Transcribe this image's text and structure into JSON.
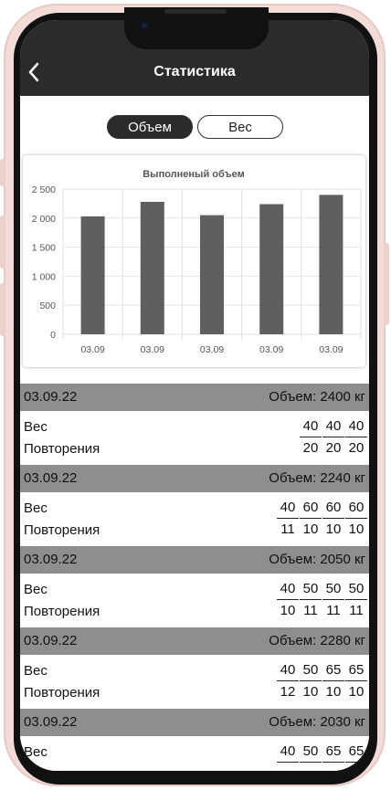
{
  "header": {
    "title": "Статистика"
  },
  "tabs": [
    {
      "label": "Объем",
      "active": true
    },
    {
      "label": "Вес",
      "active": false
    }
  ],
  "chart_data": {
    "type": "bar",
    "title": "Выполненый объем",
    "categories": [
      "03.09",
      "03.09",
      "03.09",
      "03.09",
      "03.09"
    ],
    "values": [
      2030,
      2280,
      2050,
      2240,
      2400
    ],
    "ylim": [
      0,
      2500
    ],
    "yticks": [
      "0",
      "500",
      "1 000",
      "1 500",
      "2 000",
      "2 500"
    ],
    "grid": true,
    "bar_color": "#5f5f5f"
  },
  "labels": {
    "weight": "Вес",
    "reps": "Повторения"
  },
  "sessions": [
    {
      "date": "03.09.22",
      "volume": "Объем: 2400 кг",
      "weights": [
        "40",
        "40",
        "40"
      ],
      "reps": [
        "20",
        "20",
        "20"
      ]
    },
    {
      "date": "03.09.22",
      "volume": "Объем: 2240 кг",
      "weights": [
        "40",
        "60",
        "60",
        "60"
      ],
      "reps": [
        "11",
        "10",
        "10",
        "10"
      ]
    },
    {
      "date": "03.09.22",
      "volume": "Объем: 2050 кг",
      "weights": [
        "40",
        "50",
        "50",
        "50"
      ],
      "reps": [
        "10",
        "11",
        "11",
        "11"
      ]
    },
    {
      "date": "03.09.22",
      "volume": "Объем: 2280 кг",
      "weights": [
        "40",
        "50",
        "65",
        "65"
      ],
      "reps": [
        "12",
        "10",
        "10",
        "10"
      ]
    },
    {
      "date": "03.09.22",
      "volume": "Объем: 2030 кг",
      "weights": [
        "40",
        "50",
        "65",
        "65"
      ],
      "reps": [
        "",
        "",
        "",
        ""
      ]
    }
  ]
}
